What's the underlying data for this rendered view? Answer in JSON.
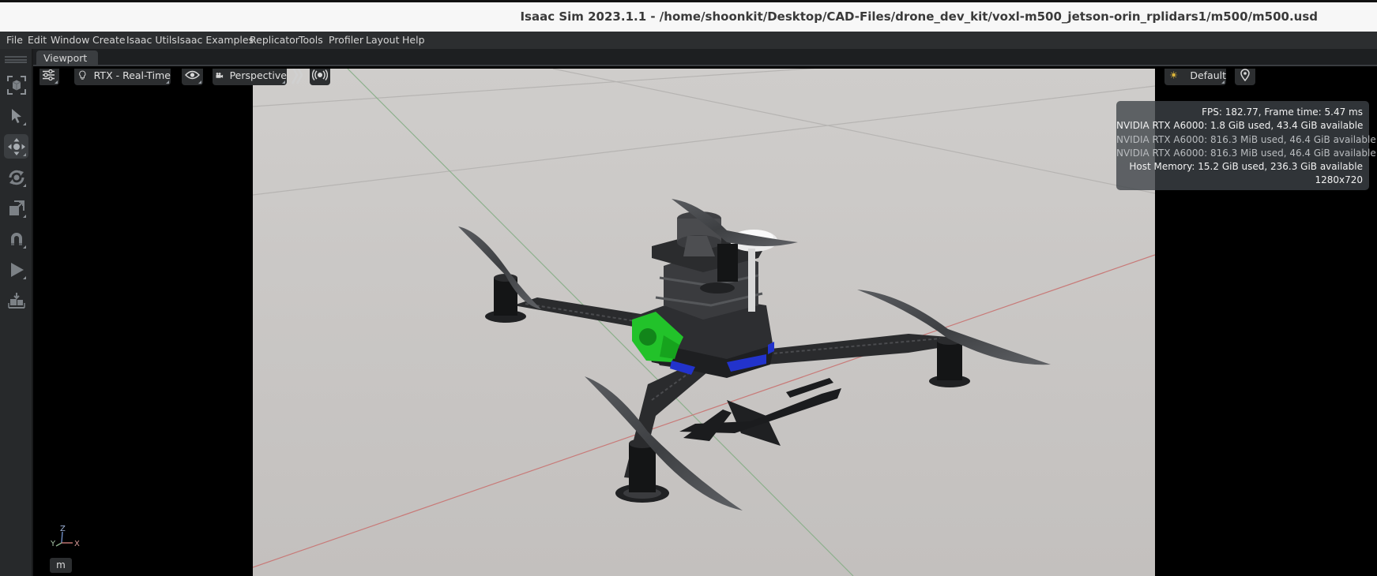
{
  "window": {
    "title": "Isaac Sim 2023.1.1 - /home/shoonkit/Desktop/CAD-Files/drone_dev_kit/voxl-m500_jetson-orin_rplidars1/m500/m500.usd"
  },
  "menu": {
    "items": [
      "File",
      "Edit",
      "Window",
      "Create",
      "Isaac Utils",
      "Isaac Examples",
      "Replicator",
      "Tools",
      "Profiler",
      "Layout",
      "Help"
    ]
  },
  "toolbar": {
    "tools": [
      {
        "name": "select-mode-icon",
        "active": false
      },
      {
        "name": "select-arrow-icon",
        "active": false
      },
      {
        "name": "move-icon",
        "active": true
      },
      {
        "name": "rotate-icon",
        "active": false
      },
      {
        "name": "scale-icon",
        "active": false
      },
      {
        "name": "snap-magnet-icon",
        "active": false
      },
      {
        "name": "play-icon",
        "active": false
      },
      {
        "name": "load-icon",
        "active": false
      }
    ]
  },
  "tabs": {
    "viewport": "Viewport"
  },
  "viewport": {
    "render_mode": "RTX - Real-Time",
    "camera": "Perspective",
    "lighting": "Default",
    "stats": {
      "fps": "FPS: 182.77, Frame time: 5.47 ms",
      "gpu0": "NVIDIA RTX A6000: 1.8 GiB used, 43.4 GiB available",
      "gpu1": "NVIDIA RTX A6000: 816.3 MiB used, 46.4 GiB available",
      "gpu2": "NVIDIA RTX A6000: 816.3 MiB used, 46.4 GiB available",
      "host_memory": "Host Memory: 15.2 GiB used, 236.3 GiB available",
      "resolution": "1280x720"
    },
    "axes": {
      "x": "X",
      "y": "Y",
      "z": "Z"
    },
    "unit": "m"
  },
  "colors": {
    "ground": "#c9c6c4",
    "x_axis": "#c87a78",
    "z_axis": "#8cb08c",
    "accent_green": "#22c22a",
    "accent_blue": "#2233cc"
  }
}
